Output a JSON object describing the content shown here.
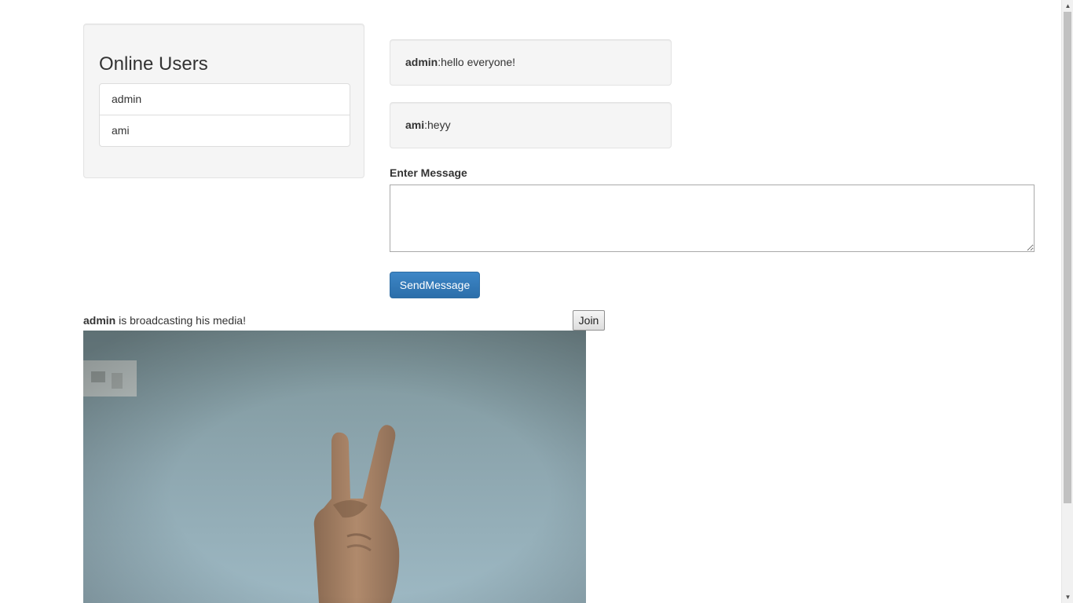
{
  "users_panel": {
    "title": "Online Users",
    "users": [
      "admin",
      "ami"
    ]
  },
  "messages": [
    {
      "user": "admin",
      "text": ":hello everyone!"
    },
    {
      "user": "ami",
      "text": ":heyy"
    }
  ],
  "composer": {
    "label": "Enter Message",
    "value": "",
    "send_label": "SendMessage"
  },
  "broadcast": {
    "user": "admin",
    "text": " is broadcasting his media!",
    "join_label": "Join"
  },
  "colors": {
    "primary_button": "#337ab7",
    "panel_background": "#f5f5f5"
  },
  "scrollbar": {
    "up_icon": "up-arrow-icon",
    "down_icon": "down-arrow-icon"
  }
}
